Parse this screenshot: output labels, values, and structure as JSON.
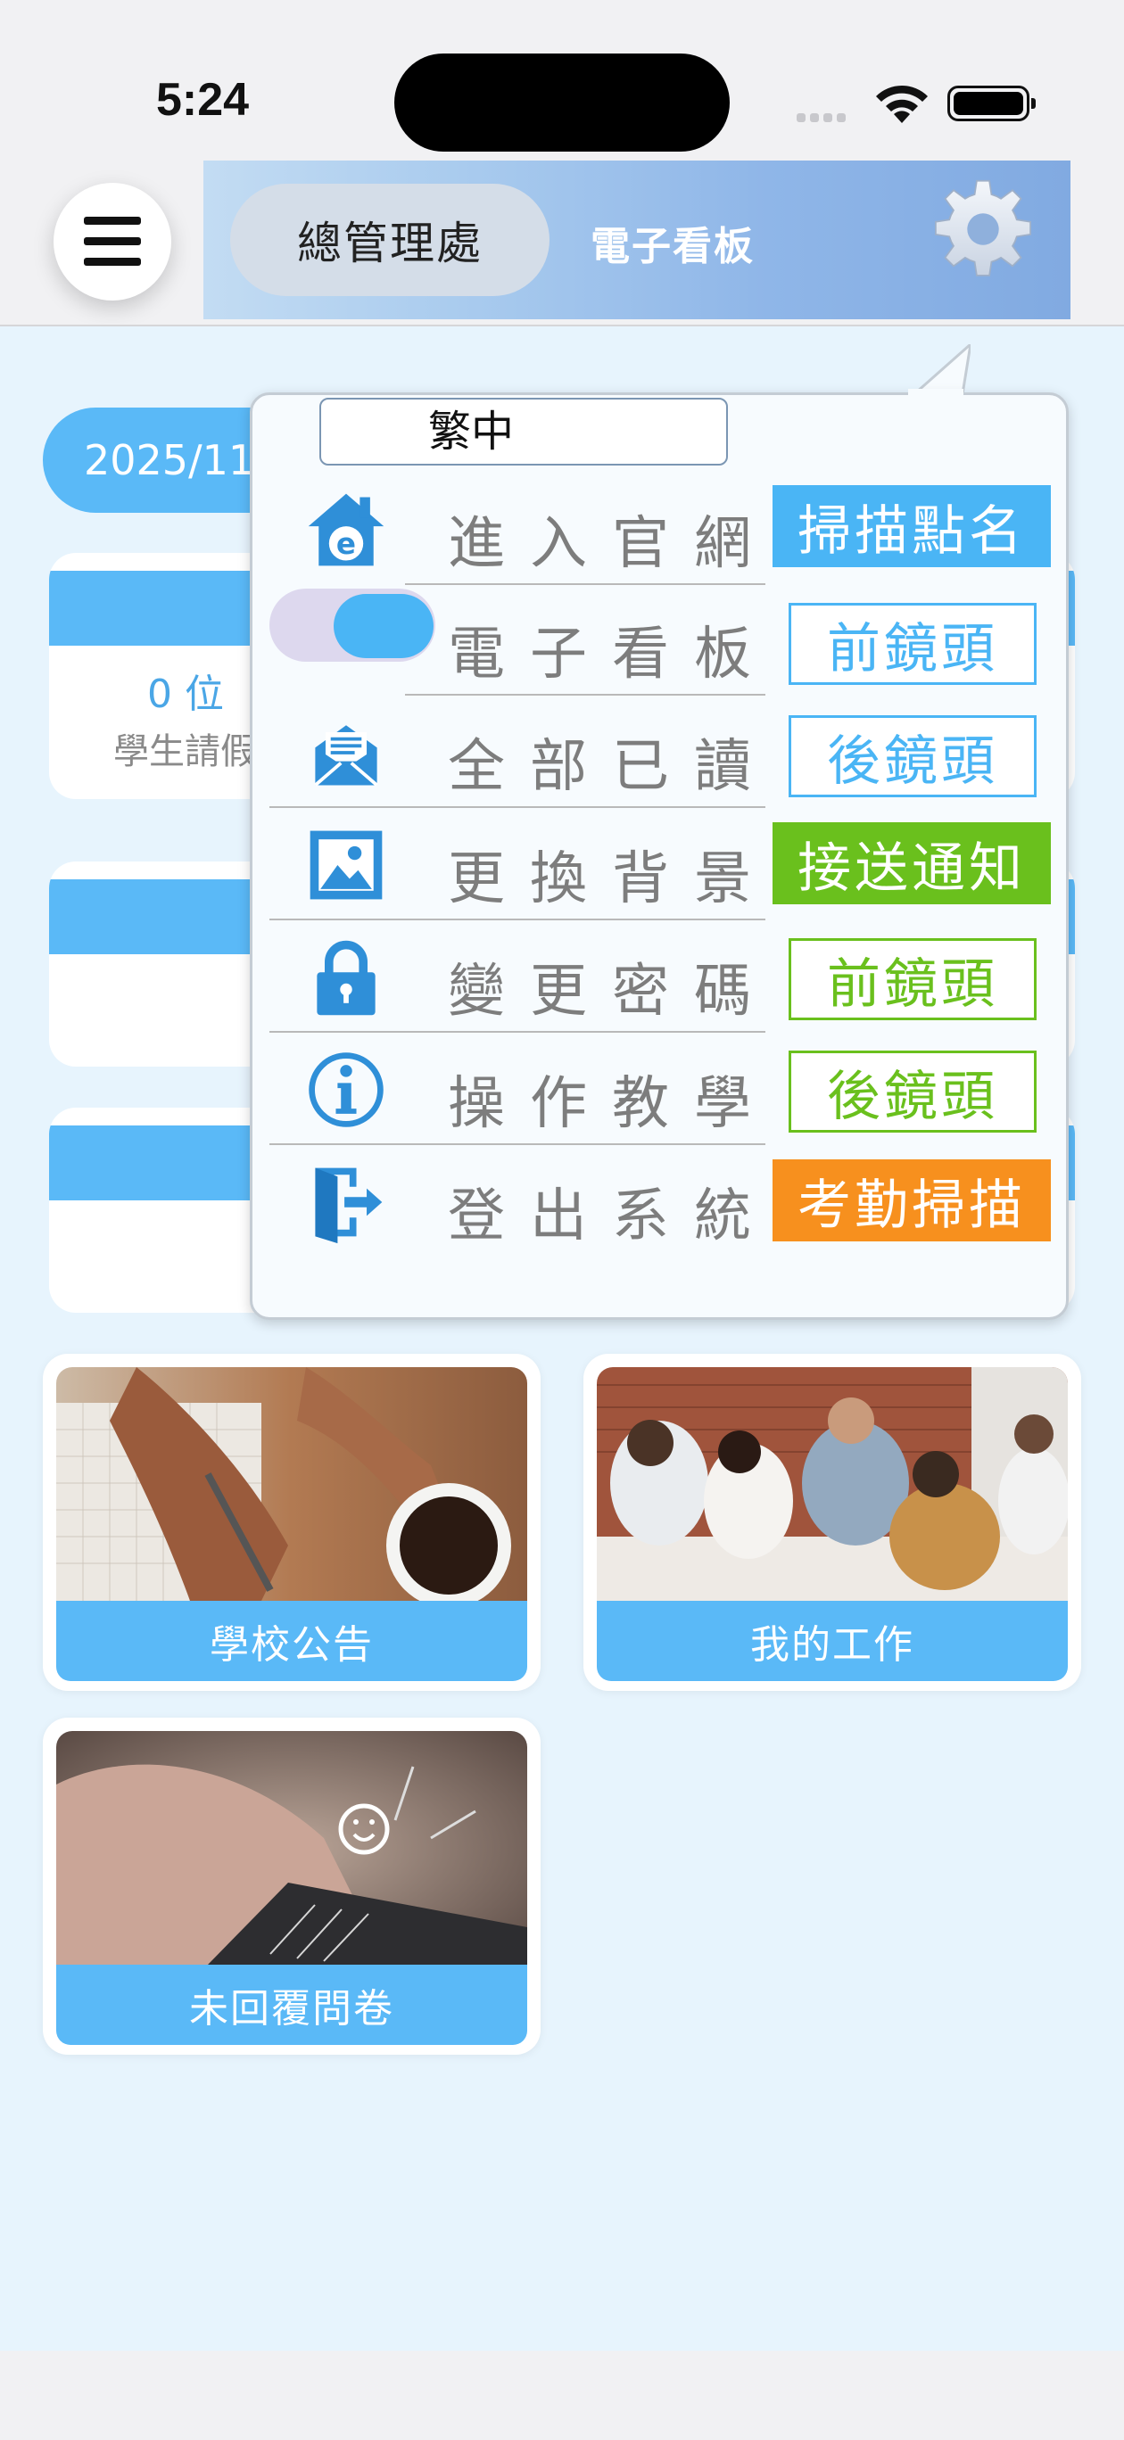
{
  "status_bar": {
    "time": "5:24"
  },
  "header": {
    "org_name": "總管理處",
    "title": "電子看板"
  },
  "dashboard": {
    "date": "2025/11",
    "count_text": "0 位",
    "count_label": "學生請假"
  },
  "tiles": [
    {
      "label": "學校公告"
    },
    {
      "label": "我的工作"
    },
    {
      "label": "未回覆問卷"
    }
  ],
  "popup": {
    "language": "繁中",
    "menu_items": [
      {
        "label": "進入官網",
        "icon": "website-home-icon"
      },
      {
        "label": "電子看板",
        "icon": "toggle-switch",
        "toggle_on": true
      },
      {
        "label": "全部已讀",
        "icon": "mail-read-icon"
      },
      {
        "label": "更換背景",
        "icon": "image-icon"
      },
      {
        "label": "變更密碼",
        "icon": "lock-icon"
      },
      {
        "label": "操作教學",
        "icon": "info-icon"
      },
      {
        "label": "登出系統",
        "icon": "logout-door-icon"
      }
    ],
    "actions": [
      {
        "label": "掃描點名",
        "style": "filled",
        "color": "#4ab5f5"
      },
      {
        "label": "前鏡頭",
        "style": "outline",
        "color": "#4ab5f5"
      },
      {
        "label": "後鏡頭",
        "style": "outline",
        "color": "#4ab5f5"
      },
      {
        "label": "接送通知",
        "style": "filled",
        "color": "#6ac01d"
      },
      {
        "label": "前鏡頭",
        "style": "outline",
        "color": "#6ac01d"
      },
      {
        "label": "後鏡頭",
        "style": "outline",
        "color": "#6ac01d"
      },
      {
        "label": "考勤掃描",
        "style": "filled",
        "color": "#f7901e"
      }
    ]
  },
  "colors": {
    "accent": "#5ab9f7",
    "green": "#6ac01d",
    "orange": "#f7901e"
  }
}
